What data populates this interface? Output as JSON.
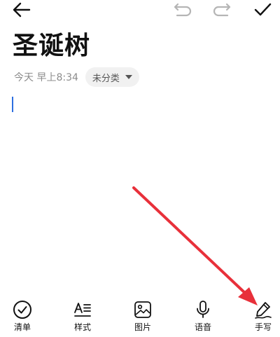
{
  "topbar": {
    "back_icon": "arrow-left-icon",
    "undo_icon": "undo-icon",
    "redo_icon": "redo-icon",
    "done_icon": "checkmark-icon"
  },
  "note": {
    "title": "圣诞树",
    "time": "今天 早上8:34",
    "category": "未分类"
  },
  "toolbar": {
    "items": [
      {
        "label": "清单",
        "icon": "checklist-icon"
      },
      {
        "label": "样式",
        "icon": "text-style-icon"
      },
      {
        "label": "图片",
        "icon": "image-icon"
      },
      {
        "label": "语音",
        "icon": "microphone-icon"
      },
      {
        "label": "手写",
        "icon": "handwriting-pen-icon"
      }
    ]
  },
  "colors": {
    "cursor": "#2d6fe0",
    "annotation_arrow": "#e8303a",
    "chip_bg": "#f1f1f1",
    "meta_text": "#8c8c8c"
  }
}
